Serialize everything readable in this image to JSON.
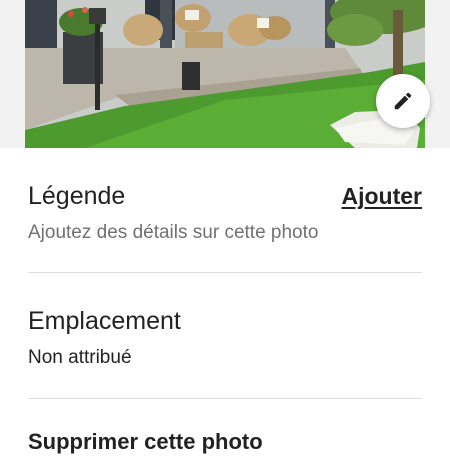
{
  "photo": {
    "edit_icon": "pencil-icon"
  },
  "caption": {
    "title": "Légende",
    "action_label": "Ajouter",
    "hint": "Ajoutez des détails sur cette photo"
  },
  "location": {
    "title": "Emplacement",
    "value": "Non attribué"
  },
  "delete": {
    "label": "Supprimer cette photo"
  }
}
